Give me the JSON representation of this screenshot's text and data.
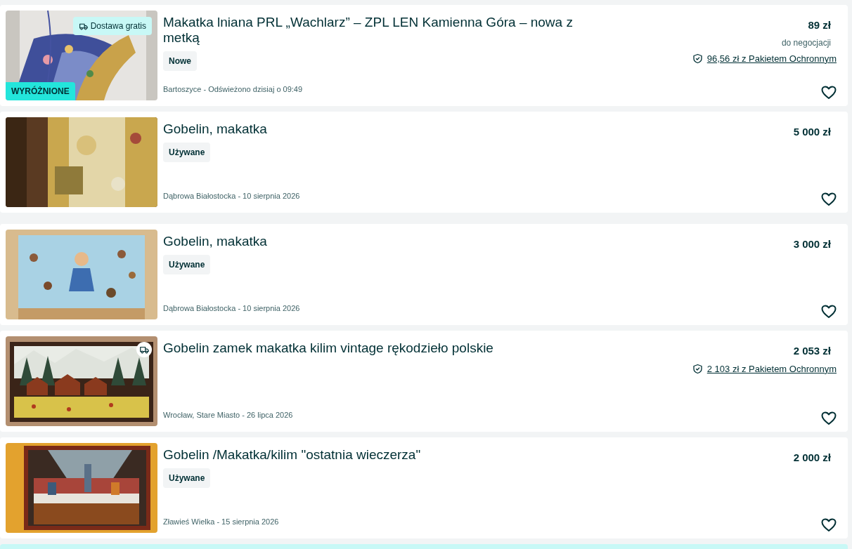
{
  "listings": [
    {
      "title": "Makatka lniana PRL „Wachlarz” – ZPL LEN Kamienna Góra – nowa z metką",
      "condition": "Nowe",
      "location_date": "Bartoszyce - Odświeżono dzisiaj o 09:49",
      "price": "89 zł",
      "negotiable": "do negocjacji",
      "protection": "96,56 zł z Pakietem Ochronnym",
      "featured_label": "WYRÓŻNIONE",
      "delivery_label": "Dostawa gratis",
      "favorited": false
    },
    {
      "title": "Gobelin, makatka",
      "condition": "Używane",
      "location_date": "Dąbrowa Białostocka - 10 sierpnia 2026",
      "price": "5 000 zł",
      "favorited": false
    },
    {
      "title": "Gobelin, makatka",
      "condition": "Używane",
      "location_date": "Dąbrowa Białostocka - 10 sierpnia 2026",
      "price": "3 000 zł",
      "favorited": false
    },
    {
      "title": "Gobelin zamek makatka kilim vintage rękodzieło polskie",
      "location_date": "Wrocław, Stare Miasto - 26 lipca 2026",
      "price": "2 053 zł",
      "protection": "2 103 zł z Pakietem Ochronnym",
      "delivery_icon": true,
      "favorited": false
    },
    {
      "title": "Gobelin /Makatka/kilim \"ostatnia wieczerza\"",
      "condition": "Używane",
      "location_date": "Zławieś Wielka - 15 sierpnia 2026",
      "price": "2 000 zł",
      "favorited": false
    }
  ]
}
